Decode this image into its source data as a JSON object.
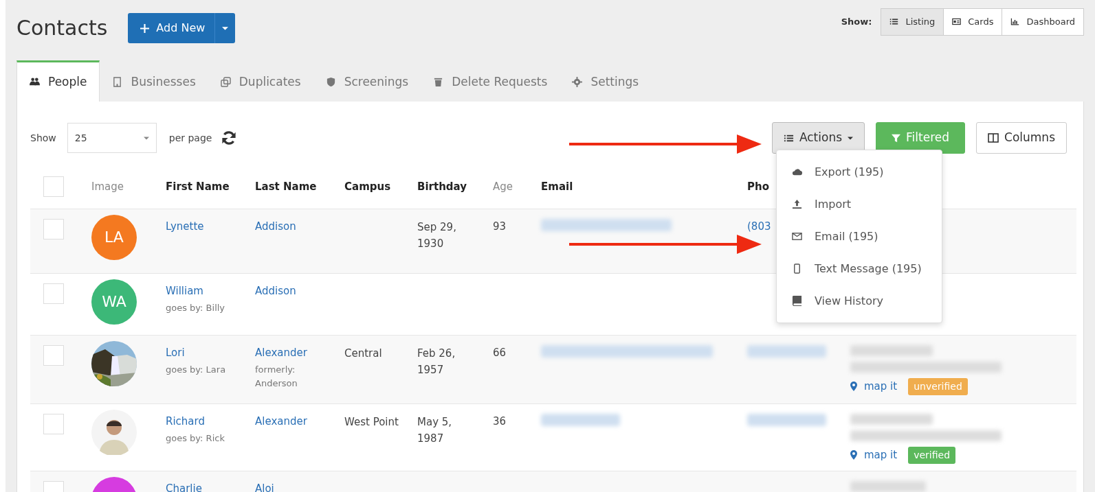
{
  "page": {
    "title": "Contacts",
    "add_button": "Add New"
  },
  "view_switch": {
    "label": "Show:",
    "options": [
      {
        "label": "Listing",
        "selected": true
      },
      {
        "label": "Cards",
        "selected": false
      },
      {
        "label": "Dashboard",
        "selected": false
      }
    ]
  },
  "tabs": [
    {
      "label": "People",
      "selected": true
    },
    {
      "label": "Businesses",
      "selected": false
    },
    {
      "label": "Duplicates",
      "selected": false
    },
    {
      "label": "Screenings",
      "selected": false
    },
    {
      "label": "Delete Requests",
      "selected": false
    },
    {
      "label": "Settings",
      "selected": false
    }
  ],
  "toolbar": {
    "show_label": "Show",
    "per_page": "25",
    "per_page_label": "per page",
    "actions_button": "Actions",
    "filter_button": "Filtered",
    "columns_button": "Columns"
  },
  "actions_menu": {
    "expanded": true,
    "items": [
      {
        "label": "Export (195)"
      },
      {
        "label": "Import"
      },
      {
        "label": "Email (195)"
      },
      {
        "label": "Text Message (195)"
      },
      {
        "label": "View History"
      }
    ]
  },
  "table": {
    "select_all_checked": false,
    "columns": [
      {
        "label": "Image",
        "sortable": false
      },
      {
        "label": "First Name",
        "sortable": true
      },
      {
        "label": "Last Name",
        "sortable": true
      },
      {
        "label": "Campus",
        "sortable": true
      },
      {
        "label": "Birthday",
        "sortable": true
      },
      {
        "label": "Age",
        "sortable": false
      },
      {
        "label": "Email",
        "sortable": true
      },
      {
        "label": "Pho",
        "sortable": true
      }
    ],
    "rows": [
      {
        "avatar": {
          "kind": "initials",
          "text": "LA",
          "color": "#f47920"
        },
        "first_name": "Lynette",
        "last_name": "Addison",
        "birthday": "Sep 29, 1930",
        "age": "93",
        "email_blurred": true,
        "phone_blurred": false,
        "address_blurred": false,
        "phone": "(803",
        "checked": false
      },
      {
        "avatar": {
          "kind": "initials",
          "text": "WA",
          "color": "#3cb878"
        },
        "first_name": "William",
        "nickname": "goes by: Billy",
        "last_name": "Addison",
        "email_blurred": false,
        "phone_blurred": false,
        "address_blurred": false,
        "checked": false
      },
      {
        "first_name": "Lori",
        "nickname": "goes by: Lara",
        "last_name": "Alexander",
        "former_name": "formerly: Anderson",
        "campus": "Central",
        "birthday": "Feb 26, 1957",
        "age": "66",
        "email_blurred": true,
        "phone_blurred": true,
        "address_blurred": true,
        "map_link": "map it",
        "status": {
          "label": "unverified",
          "color": "#f0ad4e"
        },
        "checked": false
      },
      {
        "avatar": {
          "kind": "person"
        },
        "first_name": "Richard",
        "nickname": "goes by: Rick",
        "last_name": "Alexander",
        "campus": "West Point",
        "birthday": "May 5, 1987",
        "age": "36",
        "email_blurred": true,
        "phone_blurred": true,
        "address_blurred": true,
        "map_link": "map it",
        "status": {
          "label": "verified",
          "color": "#5cb85c"
        },
        "checked": false
      },
      {
        "avatar": {
          "kind": "initials",
          "color": "#d63ce0"
        },
        "first_name": "Charlie",
        "last_name": "Aloi",
        "email_blurred": false,
        "phone_blurred": false,
        "address_blurred": true,
        "checked": false
      }
    ]
  },
  "annotations": [
    {
      "kind": "arrow"
    },
    {
      "kind": "arrow"
    }
  ]
}
